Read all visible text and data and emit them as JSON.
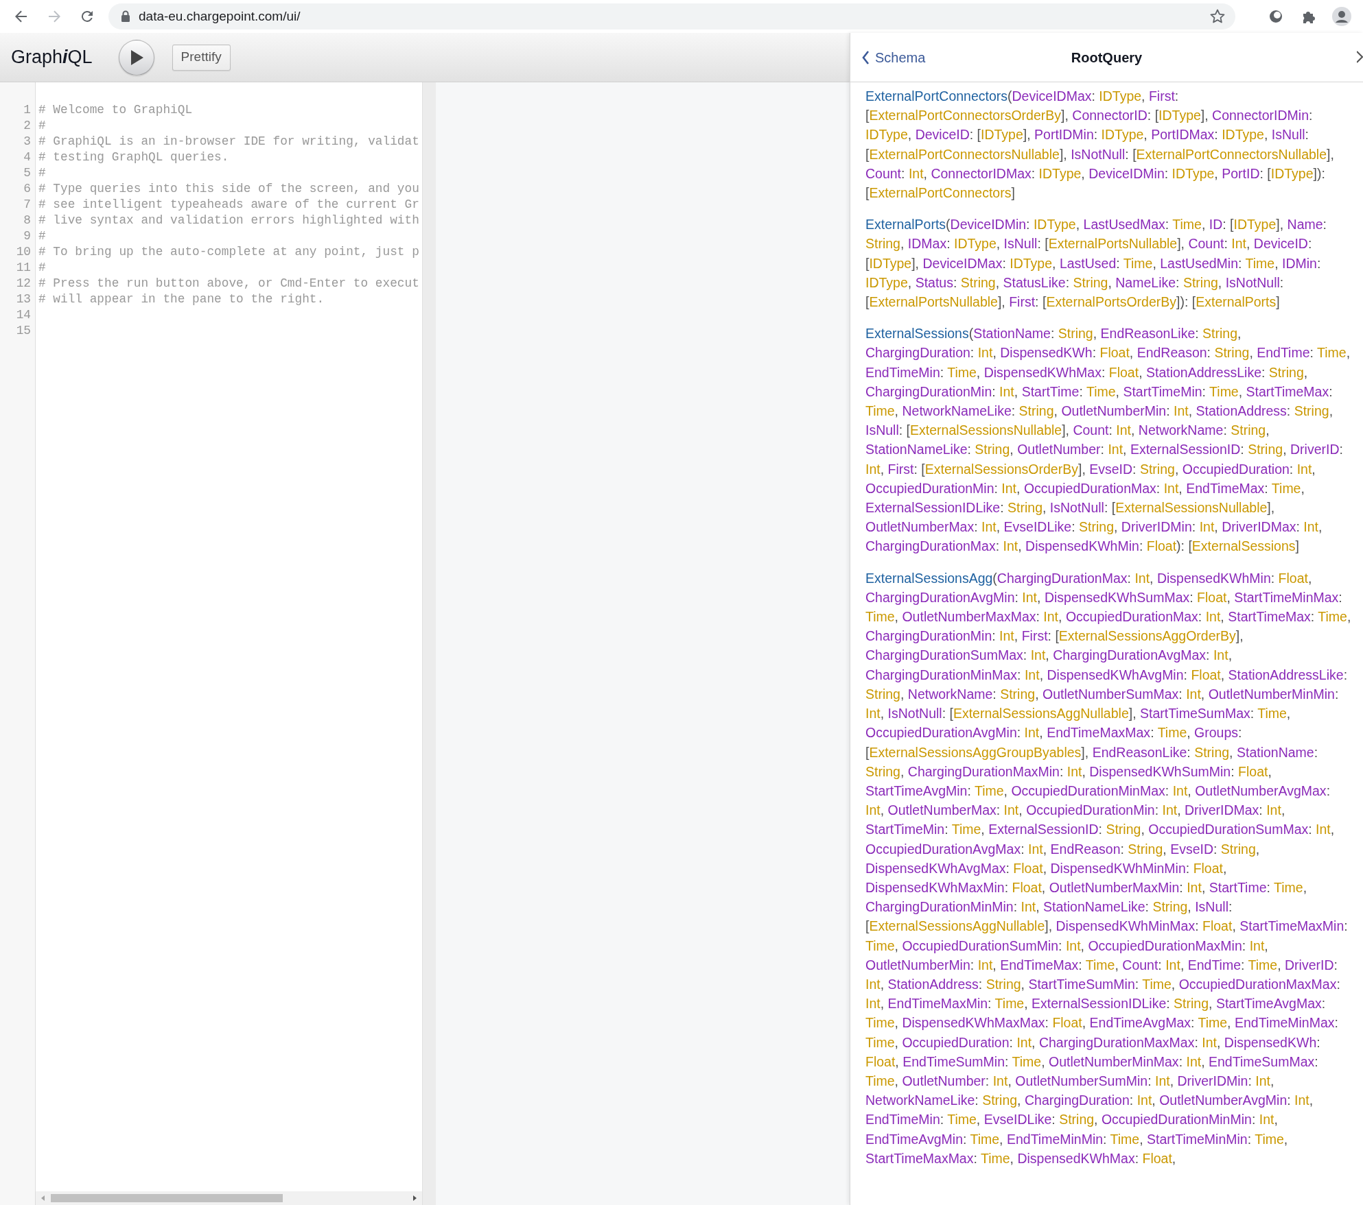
{
  "browser": {
    "url": "data-eu.chargepoint.com/ui/",
    "forward": {
      "disabled": true
    }
  },
  "toolbar": {
    "title": [
      {
        "text": "Graph",
        "italic": false
      },
      {
        "text": "i",
        "italic": true
      },
      {
        "text": "QL",
        "italic": false
      }
    ],
    "buttons": [
      "Prettify"
    ]
  },
  "editor": {
    "lines": [
      {
        "number": "1",
        "text": "# Welcome to GraphiQL"
      },
      {
        "number": "2",
        "text": "#"
      },
      {
        "number": "3",
        "text": "# GraphiQL is an in-browser IDE for writing, validat"
      },
      {
        "number": "4",
        "text": "# testing GraphQL queries."
      },
      {
        "number": "5",
        "text": "#"
      },
      {
        "number": "6",
        "text": "# Type queries into this side of the screen, and you"
      },
      {
        "number": "7",
        "text": "# see intelligent typeaheads aware of the current Gr"
      },
      {
        "number": "8",
        "text": "# live syntax and validation errors highlighted with"
      },
      {
        "number": "9",
        "text": "#"
      },
      {
        "number": "10",
        "text": "# To bring up the auto-complete at any point, just p"
      },
      {
        "number": "11",
        "text": "#"
      },
      {
        "number": "12",
        "text": "# Press the run button above, or Cmd-Enter to execut"
      },
      {
        "number": "13",
        "text": "# will appear in the pane to the right."
      },
      {
        "number": "14"
      },
      {
        "number": "15"
      }
    ]
  },
  "docs": {
    "back_label": "Schema",
    "title": "RootQuery",
    "fields": [
      {
        "name": "ExternalPortConnectors(",
        "returns": "[ExternalPortConnectors]",
        "args": [
          {
            "name": "DeviceIDMax:",
            "type": "IDType,"
          },
          {
            "name": "First:",
            "type": "[ExternalPortConnectorsOrderBy],"
          },
          {
            "name": "ConnectorID:",
            "type": "[IDType],"
          },
          {
            "name": "ConnectorIDMin:",
            "type": "IDType,"
          },
          {
            "name": "DeviceID:",
            "type": "[IDType],"
          },
          {
            "name": "PortIDMin:",
            "type": "IDType,"
          },
          {
            "name": "PortIDMax:",
            "type": "IDType,"
          },
          {
            "name": "IsNull:",
            "type": "[ExternalPortConnectorsNullable],"
          },
          {
            "name": "IsNotNull:",
            "type": "[ExternalPortConnectorsNullable],"
          },
          {
            "name": "Count:",
            "type": "Int,"
          },
          {
            "name": "ConnectorIDMax:",
            "type": "IDType,"
          },
          {
            "name": "DeviceIDMin:",
            "type": "IDType,"
          },
          {
            "name": "PortID:",
            "type": "[IDType]):"
          }
        ]
      },
      {
        "name": "ExternalPorts(",
        "returns": "[ExternalPorts]",
        "args": [
          {
            "name": "DeviceIDMin:",
            "type": "IDType,"
          },
          {
            "name": "LastUsedMax:",
            "type": "Time,"
          },
          {
            "name": "ID:",
            "type": "[IDType],"
          },
          {
            "name": "Name:",
            "type": "String,"
          },
          {
            "name": "IDMax:",
            "type": "IDType,"
          },
          {
            "name": "IsNull:",
            "type": "[ExternalPortsNullable],"
          },
          {
            "name": "Count:",
            "type": "Int,"
          },
          {
            "name": "DeviceID:",
            "type": "[IDType],"
          },
          {
            "name": "DeviceIDMax:",
            "type": "IDType,"
          },
          {
            "name": "LastUsed:",
            "type": "Time,"
          },
          {
            "name": "LastUsedMin:",
            "type": "Time,"
          },
          {
            "name": "IDMin:",
            "type": "IDType,"
          },
          {
            "name": "Status:",
            "type": "String,"
          },
          {
            "name": "StatusLike:",
            "type": "String,"
          },
          {
            "name": "NameLike:",
            "type": "String,"
          },
          {
            "name": "IsNotNull:",
            "type": "[ExternalPortsNullable],"
          },
          {
            "name": "First:",
            "type": "[ExternalPortsOrderBy]):"
          }
        ]
      },
      {
        "name": "ExternalSessions(",
        "returns": "[ExternalSessions]",
        "args": [
          {
            "name": "StationName:",
            "type": "String,"
          },
          {
            "name": "EndReasonLike:",
            "type": "String,"
          },
          {
            "name": "ChargingDuration:",
            "type": "Int,"
          },
          {
            "name": "DispensedKWh:",
            "type": "Float,"
          },
          {
            "name": "EndReason:",
            "type": "String,"
          },
          {
            "name": "EndTime:",
            "type": "Time,"
          },
          {
            "name": "EndTimeMin:",
            "type": "Time,"
          },
          {
            "name": "DispensedKWhMax:",
            "type": "Float,"
          },
          {
            "name": "StationAddressLike:",
            "type": "String,"
          },
          {
            "name": "ChargingDurationMin:",
            "type": "Int,"
          },
          {
            "name": "StartTime:",
            "type": "Time,"
          },
          {
            "name": "StartTimeMin:",
            "type": "Time,"
          },
          {
            "name": "StartTimeMax:",
            "type": "Time,"
          },
          {
            "name": "NetworkNameLike:",
            "type": "String,"
          },
          {
            "name": "OutletNumberMin:",
            "type": "Int,"
          },
          {
            "name": "StationAddress:",
            "type": "String,"
          },
          {
            "name": "IsNull:",
            "type": "[ExternalSessionsNullable],"
          },
          {
            "name": "Count:",
            "type": "Int,"
          },
          {
            "name": "NetworkName:",
            "type": "String,"
          },
          {
            "name": "StationNameLike:",
            "type": "String,"
          },
          {
            "name": "OutletNumber:",
            "type": "Int,"
          },
          {
            "name": "ExternalSessionID:",
            "type": "String,"
          },
          {
            "name": "DriverID:",
            "type": "Int,"
          },
          {
            "name": "First:",
            "type": "[ExternalSessionsOrderBy],"
          },
          {
            "name": "EvseID:",
            "type": "String,"
          },
          {
            "name": "OccupiedDuration:",
            "type": "Int,"
          },
          {
            "name": "OccupiedDurationMin:",
            "type": "Int,"
          },
          {
            "name": "OccupiedDurationMax:",
            "type": "Int,"
          },
          {
            "name": "EndTimeMax:",
            "type": "Time,"
          },
          {
            "name": "ExternalSessionIDLike:",
            "type": "String,"
          },
          {
            "name": "IsNotNull:",
            "type": "[ExternalSessionsNullable],"
          },
          {
            "name": "OutletNumberMax:",
            "type": "Int,"
          },
          {
            "name": "EvseIDLike:",
            "type": "String,"
          },
          {
            "name": "DriverIDMin:",
            "type": "Int,"
          },
          {
            "name": "DriverIDMax:",
            "type": "Int,"
          },
          {
            "name": "ChargingDurationMax:",
            "type": "Int,"
          },
          {
            "name": "DispensedKWhMin:",
            "type": "Float):"
          }
        ]
      },
      {
        "name": "ExternalSessionsAgg(",
        "args": [
          {
            "name": "ChargingDurationMax:",
            "type": "Int,"
          },
          {
            "name": "DispensedKWhMin:",
            "type": "Float,"
          },
          {
            "name": "ChargingDurationAvgMin:",
            "type": "Int,"
          },
          {
            "name": "DispensedKWhSumMax:",
            "type": "Float,"
          },
          {
            "name": "StartTimeMinMax:",
            "type": "Time,"
          },
          {
            "name": "OutletNumberMaxMax:",
            "type": "Int,"
          },
          {
            "name": "OccupiedDurationMax:",
            "type": "Int,"
          },
          {
            "name": "StartTimeMax:",
            "type": "Time,"
          },
          {
            "name": "ChargingDurationMin:",
            "type": "Int,"
          },
          {
            "name": "First:",
            "type": "[ExternalSessionsAggOrderBy],"
          },
          {
            "name": "ChargingDurationSumMax:",
            "type": "Int,"
          },
          {
            "name": "ChargingDurationAvgMax:",
            "type": "Int,"
          },
          {
            "name": "ChargingDurationMinMax:",
            "type": "Int,"
          },
          {
            "name": "DispensedKWhAvgMin:",
            "type": "Float,"
          },
          {
            "name": "StationAddressLike:",
            "type": "String,"
          },
          {
            "name": "NetworkName:",
            "type": "String,"
          },
          {
            "name": "OutletNumberSumMax:",
            "type": "Int,"
          },
          {
            "name": "OutletNumberMinMin:",
            "type": "Int,"
          },
          {
            "name": "IsNotNull:",
            "type": "[ExternalSessionsAggNullable],"
          },
          {
            "name": "StartTimeSumMax:",
            "type": "Time,"
          },
          {
            "name": "OccupiedDurationAvgMin:",
            "type": "Int,"
          },
          {
            "name": "EndTimeMaxMax:",
            "type": "Time,"
          },
          {
            "name": "Groups:",
            "type": "[ExternalSessionsAggGroupByables],"
          },
          {
            "name": "EndReasonLike:",
            "type": "String,"
          },
          {
            "name": "StationName:",
            "type": "String,"
          },
          {
            "name": "ChargingDurationMaxMin:",
            "type": "Int,"
          },
          {
            "name": "DispensedKWhSumMin:",
            "type": "Float,"
          },
          {
            "name": "StartTimeAvgMin:",
            "type": "Time,"
          },
          {
            "name": "OccupiedDurationMinMax:",
            "type": "Int,"
          },
          {
            "name": "OutletNumberAvgMax:",
            "type": "Int,"
          },
          {
            "name": "OutletNumberMax:",
            "type": "Int,"
          },
          {
            "name": "OccupiedDurationMin:",
            "type": "Int,"
          },
          {
            "name": "DriverIDMax:",
            "type": "Int,"
          },
          {
            "name": "StartTimeMin:",
            "type": "Time,"
          },
          {
            "name": "ExternalSessionID:",
            "type": "String,"
          },
          {
            "name": "OccupiedDurationSumMax:",
            "type": "Int,"
          },
          {
            "name": "OccupiedDurationAvgMax:",
            "type": "Int,"
          },
          {
            "name": "EndReason:",
            "type": "String,"
          },
          {
            "name": "EvseID:",
            "type": "String,"
          },
          {
            "name": "DispensedKWhAvgMax:",
            "type": "Float,"
          },
          {
            "name": "DispensedKWhMinMin:",
            "type": "Float,"
          },
          {
            "name": "DispensedKWhMaxMin:",
            "type": "Float,"
          },
          {
            "name": "OutletNumberMaxMin:",
            "type": "Int,"
          },
          {
            "name": "StartTime:",
            "type": "Time,"
          },
          {
            "name": "ChargingDurationMinMin:",
            "type": "Int,"
          },
          {
            "name": "StationNameLike:",
            "type": "String,"
          },
          {
            "name": "IsNull:",
            "type": "[ExternalSessionsAggNullable],"
          },
          {
            "name": "DispensedKWhMinMax:",
            "type": "Float,"
          },
          {
            "name": "StartTimeMaxMin:",
            "type": "Time,"
          },
          {
            "name": "OccupiedDurationSumMin:",
            "type": "Int,"
          },
          {
            "name": "OccupiedDurationMaxMin:",
            "type": "Int,"
          },
          {
            "name": "OutletNumberMin:",
            "type": "Int,"
          },
          {
            "name": "EndTimeMax:",
            "type": "Time,"
          },
          {
            "name": "Count:",
            "type": "Int,"
          },
          {
            "name": "EndTime:",
            "type": "Time,"
          },
          {
            "name": "DriverID:",
            "type": "Int,"
          },
          {
            "name": "StationAddress:",
            "type": "String,"
          },
          {
            "name": "StartTimeSumMin:",
            "type": "Time,"
          },
          {
            "name": "OccupiedDurationMaxMax:",
            "type": "Int,"
          },
          {
            "name": "EndTimeMaxMin:",
            "type": "Time,"
          },
          {
            "name": "ExternalSessionIDLike:",
            "type": "String,"
          },
          {
            "name": "StartTimeAvgMax:",
            "type": "Time,"
          },
          {
            "name": "DispensedKWhMaxMax:",
            "type": "Float,"
          },
          {
            "name": "EndTimeAvgMax:",
            "type": "Time,"
          },
          {
            "name": "EndTimeMinMax:",
            "type": "Time,"
          },
          {
            "name": "OccupiedDuration:",
            "type": "Int,"
          },
          {
            "name": "ChargingDurationMaxMax:",
            "type": "Int,"
          },
          {
            "name": "DispensedKWh:",
            "type": "Float,"
          },
          {
            "name": "EndTimeSumMin:",
            "type": "Time,"
          },
          {
            "name": "OutletNumberMinMax:",
            "type": "Int,"
          },
          {
            "name": "EndTimeSumMax:",
            "type": "Time,"
          },
          {
            "name": "OutletNumber:",
            "type": "Int,"
          },
          {
            "name": "OutletNumberSumMin:",
            "type": "Int,"
          },
          {
            "name": "DriverIDMin:",
            "type": "Int,"
          },
          {
            "name": "NetworkNameLike:",
            "type": "String,"
          },
          {
            "name": "ChargingDuration:",
            "type": "Int,"
          },
          {
            "name": "OutletNumberAvgMin:",
            "type": "Int,"
          },
          {
            "name": "EndTimeMin:",
            "type": "Time,"
          },
          {
            "name": "EvseIDLike:",
            "type": "String,"
          },
          {
            "name": "OccupiedDurationMinMin:",
            "type": "Int,"
          },
          {
            "name": "EndTimeAvgMin:",
            "type": "Time,"
          },
          {
            "name": "EndTimeMinMin:",
            "type": "Time,"
          },
          {
            "name": "StartTimeMinMin:",
            "type": "Time,"
          },
          {
            "name": "StartTimeMaxMax:",
            "type": "Time,"
          },
          {
            "name": "DispensedKWhMax:",
            "type": "Float,"
          }
        ]
      }
    ]
  }
}
